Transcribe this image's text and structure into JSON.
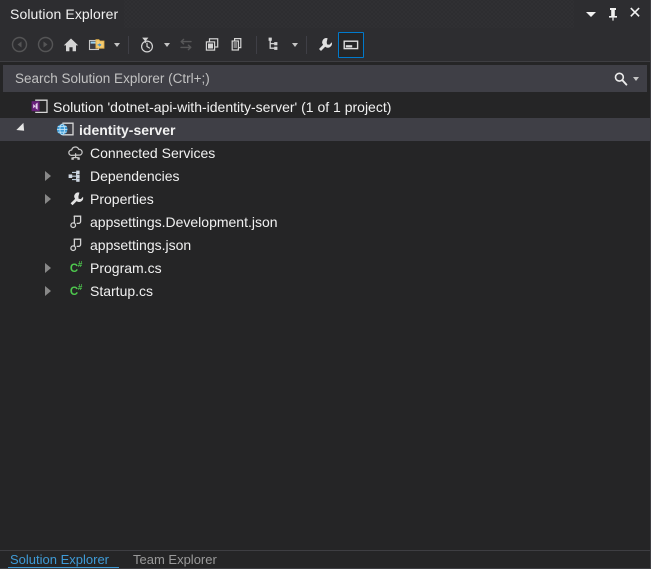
{
  "window": {
    "title": "Solution Explorer",
    "controls": [
      {
        "name": "window-menu-chevron",
        "icon": "chevron-down-icon",
        "label": "▾"
      },
      {
        "name": "auto-hide-pin",
        "icon": "pin-icon",
        "label": "⚐"
      },
      {
        "name": "close-window",
        "icon": "close-icon",
        "label": "✕"
      }
    ]
  },
  "toolbar": {
    "items": [
      {
        "name": "back-button",
        "icon": "back-arrow-icon",
        "tooltip": "Back",
        "state": "disabled"
      },
      {
        "name": "forward-button",
        "icon": "forward-arrow-icon",
        "tooltip": "Forward",
        "state": "disabled"
      },
      {
        "name": "home-button",
        "icon": "home-icon",
        "tooltip": "Home",
        "state": "normal"
      },
      {
        "name": "solution-views-button",
        "icon": "solution-folder-icon",
        "tooltip": "Switch Views",
        "state": "normal",
        "dropdown": true
      },
      {
        "name": "pending-changes-button",
        "icon": "clock-filter-icon",
        "tooltip": "Pending Changes Filter",
        "state": "normal",
        "dropdown": true
      },
      {
        "name": "sync-button",
        "icon": "sync-arrows-icon",
        "tooltip": "Sync with Active Document",
        "state": "disabled"
      },
      {
        "name": "refresh-button",
        "icon": "refresh-windows-icon",
        "tooltip": "Refresh",
        "state": "normal"
      },
      {
        "name": "collapse-all-button",
        "icon": "collapse-all-icon",
        "tooltip": "Collapse All",
        "state": "normal"
      },
      {
        "name": "show-all-files-button",
        "icon": "show-all-files-icon",
        "tooltip": "Show All Files",
        "state": "normal",
        "dropdown": true
      },
      {
        "name": "properties-wrench-button",
        "icon": "wrench-icon",
        "tooltip": "Properties",
        "state": "normal"
      },
      {
        "name": "preview-pane-button",
        "icon": "properties-window-icon",
        "tooltip": "Preview Selected Items",
        "state": "selected"
      }
    ]
  },
  "search": {
    "placeholder": "Search Solution Explorer (Ctrl+;)",
    "value": "",
    "icon": "search-icon",
    "dropdown_icon": "chevron-down-icon"
  },
  "tree": {
    "nodes": [
      {
        "name": "solution-node",
        "label": "Solution 'dotnet-api-with-identity-server' (1 of 1 project)",
        "icon": "visual-studio-solution-icon",
        "indent": 0,
        "twisty": "none",
        "bold": false,
        "selected": false
      },
      {
        "name": "project-identity-server",
        "label": "identity-server",
        "icon": "web-project-globe-icon",
        "indent": 1,
        "twisty": "expanded",
        "bold": true,
        "selected": true
      },
      {
        "name": "connected-services-node",
        "label": "Connected Services",
        "icon": "cloud-connected-services-icon",
        "indent": 2,
        "twisty": "none",
        "bold": false,
        "selected": false
      },
      {
        "name": "dependencies-node",
        "label": "Dependencies",
        "icon": "dependencies-nodes-icon",
        "indent": 2,
        "twisty": "collapsed",
        "bold": false,
        "selected": false
      },
      {
        "name": "properties-node",
        "label": "Properties",
        "icon": "wrench-icon",
        "indent": 2,
        "twisty": "collapsed",
        "bold": false,
        "selected": false
      },
      {
        "name": "file-appsettings-development-json",
        "label": "appsettings.Development.json",
        "icon": "json-file-icon",
        "indent": 2,
        "twisty": "none",
        "bold": false,
        "selected": false
      },
      {
        "name": "file-appsettings-json",
        "label": "appsettings.json",
        "icon": "json-file-icon",
        "indent": 2,
        "twisty": "none",
        "bold": false,
        "selected": false
      },
      {
        "name": "file-program-cs",
        "label": "Program.cs",
        "icon": "csharp-file-icon",
        "indent": 2,
        "twisty": "collapsed",
        "bold": false,
        "selected": false
      },
      {
        "name": "file-startup-cs",
        "label": "Startup.cs",
        "icon": "csharp-file-icon",
        "indent": 2,
        "twisty": "collapsed",
        "bold": false,
        "selected": false
      }
    ]
  },
  "bottom_tabs": [
    {
      "name": "tab-solution-explorer",
      "label": "Solution Explorer",
      "active": true
    },
    {
      "name": "tab-team-explorer",
      "label": "Team Explorer",
      "active": false
    }
  ],
  "colors": {
    "window_bg": "#252526",
    "chrome_bg": "#2d2d30",
    "selection_bg": "#3f3f46",
    "accent": "#007acc",
    "text": "#f1f1f1",
    "csharp_green": "#4ec94e",
    "tab_active": "#3f9bd6"
  }
}
